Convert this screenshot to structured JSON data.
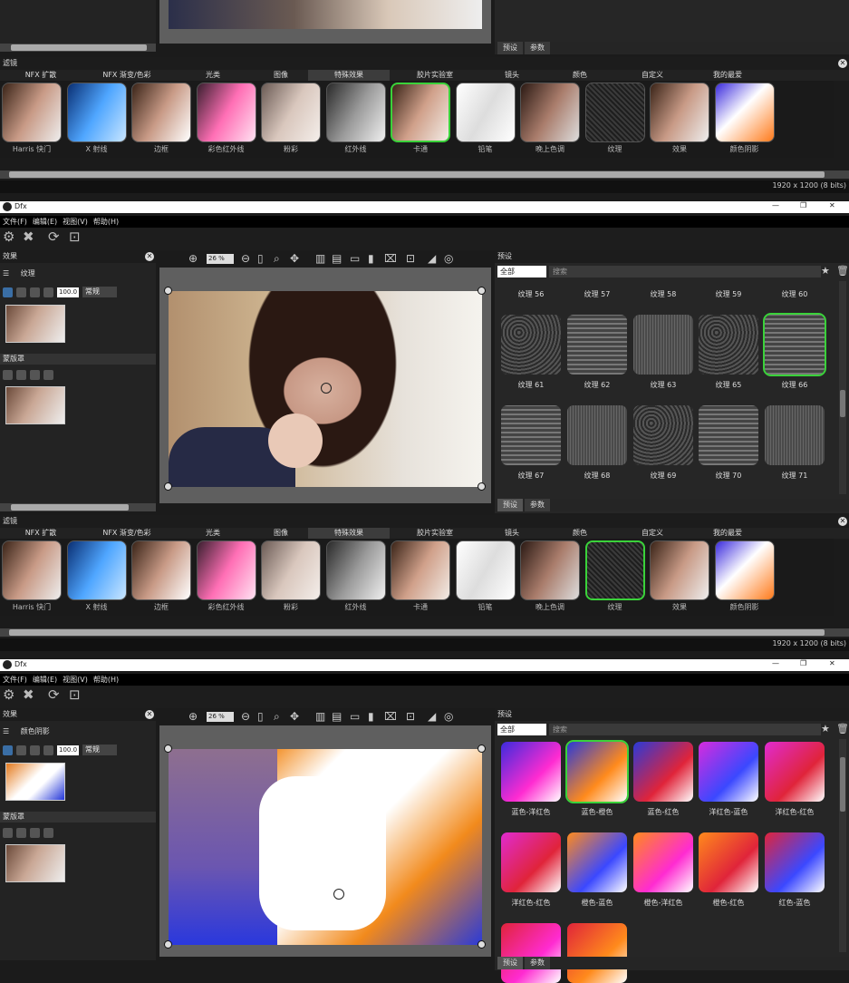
{
  "colors": {
    "accent": "#3ad23a",
    "panel": "#2c2c2c",
    "bg": "#1b1b1b"
  },
  "filters": {
    "title": "滤镜",
    "categories": [
      "NFX 扩散",
      "NFX 渐变/色彩",
      "光类",
      "图像",
      "特殊效果",
      "胶片实验室",
      "镜头",
      "颜色",
      "自定义",
      "我的最爱"
    ],
    "items": [
      "Harris 快门",
      "X 射线",
      "边框",
      "彩色红外线",
      "粉彩",
      "红外线",
      "卡通",
      "铅笔",
      "晚上色调",
      "纹理",
      "效果",
      "颜色阴影"
    ]
  },
  "status": "1920 x 1200 (8 bits)",
  "app": {
    "title": "Dfx"
  },
  "menu": [
    "文件(F)",
    "编辑(E)",
    "视图(V)",
    "帮助(H)"
  ],
  "left": {
    "header": "效果",
    "mask_header": "蒙版罩"
  },
  "panel2": {
    "effect": "纹理",
    "opacity": "100.0",
    "mode": "常规"
  },
  "panel3": {
    "effect": "颜色阴影",
    "opacity": "100.0",
    "mode": "常规"
  },
  "zoom": "26 %",
  "presets": {
    "header": "预设",
    "filter": "全部",
    "search_placeholder": "搜索",
    "tabs": [
      "预设",
      "参数"
    ]
  },
  "textures_row0": [
    "纹理 56",
    "纹理 57",
    "纹理 58",
    "纹理 59",
    "纹理 60"
  ],
  "textures_row1": [
    "纹理 61",
    "纹理 62",
    "纹理 63",
    "纹理 65",
    "纹理 66"
  ],
  "textures_row2": [
    "纹理 67",
    "纹理 68",
    "纹理 69",
    "纹理 70",
    "纹理 71"
  ],
  "shadows_row1": [
    "蓝色-洋红色",
    "蓝色-橙色",
    "蓝色-红色",
    "洋红色-蓝色",
    "洋红色-红色"
  ],
  "shadows_row2": [
    "洋红色-红色",
    "橙色-蓝色",
    "橙色-洋红色",
    "橙色-红色",
    "红色-蓝色"
  ],
  "window_controls": [
    "—",
    "❐",
    "✕"
  ]
}
